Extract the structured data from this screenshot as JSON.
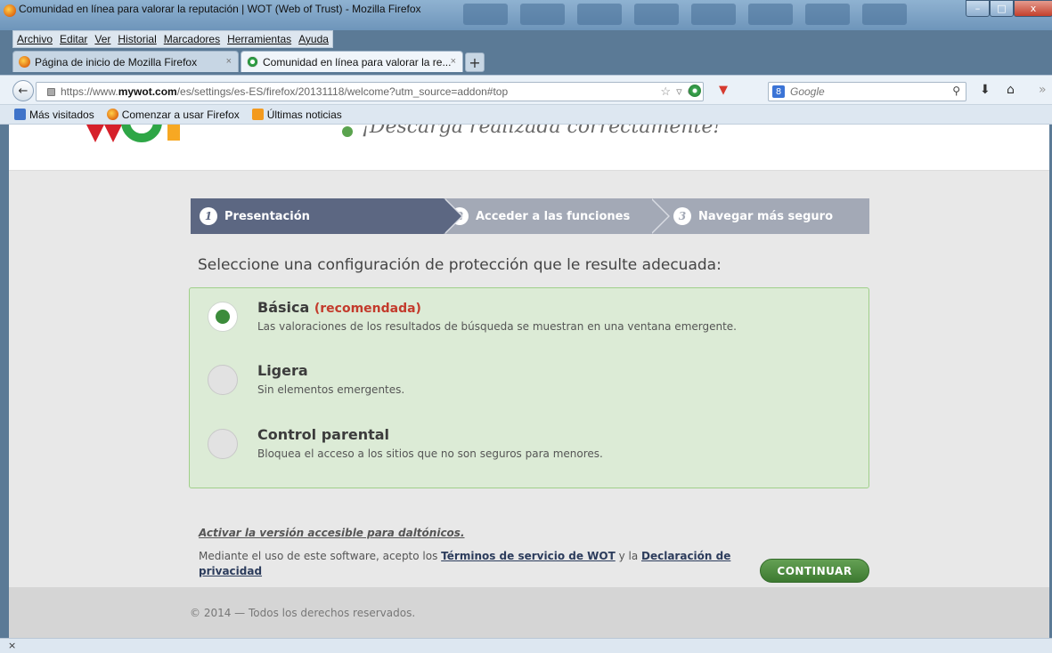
{
  "window": {
    "title": "Comunidad en línea para valorar la reputación | WOT (Web of Trust) - Mozilla Firefox",
    "minimize": "–",
    "maximize": "□",
    "close": "x"
  },
  "menubar": [
    "Archivo",
    "Editar",
    "Ver",
    "Historial",
    "Marcadores",
    "Herramientas",
    "Ayuda"
  ],
  "tabs": [
    {
      "label": "Página de inicio de Mozilla Firefox",
      "close": "×"
    },
    {
      "label": "Comunidad en línea para valorar la re...",
      "close": "×"
    }
  ],
  "new_tab": "+",
  "navbar": {
    "back": "←",
    "url_prefix": "https://www.",
    "url_domain": "mywot.com",
    "url_rest": "/es/settings/es-ES/firefox/20131118/welcome?utm_source=addon#top",
    "url_star": "☆",
    "url_dropdown": "▿",
    "url_reload": "C",
    "search_engine_badge": "8",
    "search_placeholder": "Google",
    "search_icon": "search-icon",
    "download": "⬇",
    "home": "⌂",
    "more": "»"
  },
  "bookmarks": [
    {
      "label": "Más visitados",
      "icon": "most-visited-icon"
    },
    {
      "label": "Comenzar a usar Firefox",
      "icon": "firefox-icon"
    },
    {
      "label": "Últimas noticias",
      "icon": "rss-icon"
    }
  ],
  "header": {
    "tagline": "¡Descarga realizada correctamente!"
  },
  "steps": [
    {
      "num": "1",
      "label": "Presentación",
      "active": true
    },
    {
      "num": "2",
      "label": "Acceder a las funciones",
      "active": false
    },
    {
      "num": "3",
      "label": "Navegar más seguro",
      "active": false
    }
  ],
  "config": {
    "heading": "Seleccione una configuración de protección que le resulte adecuada:",
    "options": [
      {
        "title": "Básica",
        "recommended": "(recomendada)",
        "desc": "Las valoraciones de los resultados de búsqueda se muestran en una ventana emergente.",
        "selected": true
      },
      {
        "title": "Ligera",
        "recommended": "",
        "desc": "Sin elementos emergentes.",
        "selected": false
      },
      {
        "title": "Control parental",
        "recommended": "",
        "desc": "Bloquea el acceso a los sitios que no son seguros para menores.",
        "selected": false
      }
    ]
  },
  "a11y_link": "Activar la versión accesible para daltónicos.",
  "terms": {
    "prefix": "Mediante el uso de este software, acepto los ",
    "tos_link": "Términos de servicio de WOT",
    "middle": " y la ",
    "privacy_link": "Declaración de privacidad"
  },
  "continue_label": "CONTINUAR",
  "footer": "© 2014 — Todos los derechos reservados.",
  "statusbar_close": "×",
  "colors": {
    "accent_green": "#3c8c3b",
    "step_active": "#5c6782",
    "step_inactive": "#a3a9b6",
    "recommended_red": "#c33b2c"
  }
}
